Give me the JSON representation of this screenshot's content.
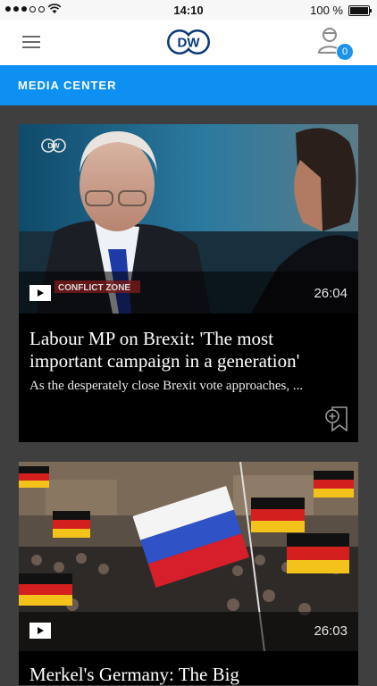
{
  "status_bar": {
    "time": "14:10",
    "battery": "100 %"
  },
  "header": {
    "logo_text": "DW",
    "notifications_count": "0"
  },
  "section": {
    "title": "MEDIA CENTER"
  },
  "cards": [
    {
      "title": "Labour MP on Brexit: 'The most important campaign in a generation'",
      "teaser": "As the desperately close Brexit vote approaches, ...",
      "duration": "26:04",
      "overlay_brand": "DW",
      "overlay_show": "CONFLICT ZONE"
    },
    {
      "title": "Merkel's Germany: The Big",
      "duration": "26:03"
    }
  ],
  "colors": {
    "accent": "#0e8ff2",
    "badge": "#1b93e8",
    "background": "#3f3f3f"
  },
  "icons": {
    "menu": "hamburger-icon",
    "user": "user-icon",
    "play": "play-icon",
    "bookmark": "bookmark-add-icon"
  }
}
